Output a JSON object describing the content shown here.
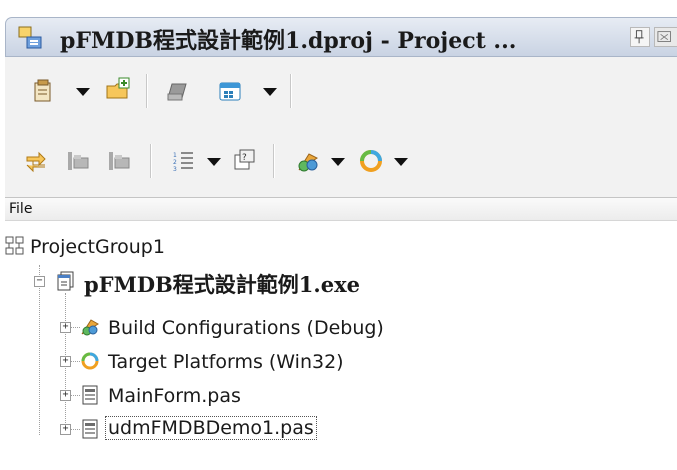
{
  "window": {
    "title": "pFMDB程式設計範例1.dproj - Project ...",
    "icons": [
      "project-manager-icon",
      "pin-icon",
      "close-icon"
    ]
  },
  "toolbar_row1": {
    "items": [
      "new-item-icon",
      "dropdown-arrow",
      "add-existing-icon",
      "remove-icon",
      "options-icon",
      "dropdown-arrow"
    ]
  },
  "toolbar_row2": {
    "items": [
      "sync-icon",
      "expand-icon",
      "collapse-icon",
      "sort-icon",
      "dropdown-arrow",
      "build-icon",
      "build-configurations-icon",
      "dropdown-arrow",
      "target-platforms-icon",
      "dropdown-arrow"
    ]
  },
  "column_header": {
    "file": "File"
  },
  "tree": {
    "group": "ProjectGroup1",
    "project": "pFMDB程式設計範例1.exe",
    "children": [
      {
        "label": "Build Configurations (Debug)",
        "icon": "build-configurations-icon"
      },
      {
        "label": "Target Platforms (Win32)",
        "icon": "target-platforms-icon"
      },
      {
        "label": "MainForm.pas",
        "icon": "pas-file-icon"
      },
      {
        "label": "udmFMDBDemo1.pas",
        "icon": "pas-file-icon"
      }
    ]
  }
}
